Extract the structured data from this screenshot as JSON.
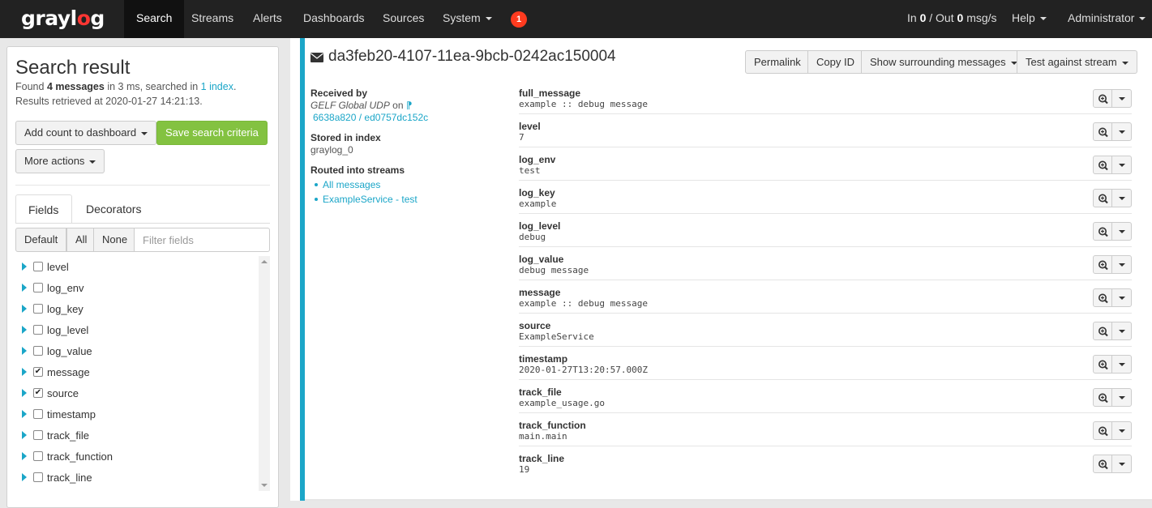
{
  "navbar": {
    "logo": {
      "text_gray": "gray",
      "text_l": "l",
      "text_o": "o",
      "text_g": "g"
    },
    "items": [
      {
        "label": "Search",
        "active": true
      },
      {
        "label": "Streams"
      },
      {
        "label": "Alerts"
      },
      {
        "label": "Dashboards"
      },
      {
        "label": "Sources"
      },
      {
        "label": "System"
      }
    ],
    "notification_count": "1",
    "throughput": {
      "in_label": "In",
      "in_value": "0",
      "sep": "/ Out",
      "out_value": "0",
      "unit": "msg/s"
    },
    "help_label": "Help",
    "user_label": "Administrator"
  },
  "sidebar": {
    "title": "Search result",
    "found_prefix": "Found",
    "found_count": "4 messages",
    "found_mid": "in 3 ms, searched in",
    "found_index_link": "1 index",
    "found_suffix": ".",
    "retrieved": "Results retrieved at 2020-01-27 14:21:13.",
    "add_count_button": "Add count to dashboard",
    "save_search_button": "Save search criteria",
    "more_actions_button": "More actions",
    "tabs": {
      "fields": "Fields",
      "decorators": "Decorators"
    },
    "filter": {
      "default": "Default",
      "all": "All",
      "none": "None",
      "placeholder": "Filter fields"
    },
    "fields": [
      {
        "name": "level",
        "checked": false
      },
      {
        "name": "log_env",
        "checked": false
      },
      {
        "name": "log_key",
        "checked": false
      },
      {
        "name": "log_level",
        "checked": false
      },
      {
        "name": "log_value",
        "checked": false
      },
      {
        "name": "message",
        "checked": true
      },
      {
        "name": "source",
        "checked": true
      },
      {
        "name": "timestamp",
        "checked": false
      },
      {
        "name": "track_file",
        "checked": false
      },
      {
        "name": "track_function",
        "checked": false
      },
      {
        "name": "track_line",
        "checked": false
      }
    ]
  },
  "message": {
    "id": "da3feb20-4107-11ea-9bcb-0242ac150004",
    "buttons": {
      "permalink": "Permalink",
      "copy_id": "Copy ID",
      "surrounding": "Show surrounding messages",
      "test_stream": "Test against stream"
    },
    "received_by_label": "Received by",
    "received_by_input": "GELF Global UDP",
    "received_on": "on",
    "received_node": "6638a820 / ed0757dc152c",
    "stored_label": "Stored in index",
    "stored_value": "graylog_0",
    "routed_label": "Routed into streams",
    "streams": [
      "All messages",
      "ExampleService - test"
    ],
    "fields": [
      {
        "key": "full_message",
        "value": "example :: debug message"
      },
      {
        "key": "level",
        "value": "7"
      },
      {
        "key": "log_env",
        "value": "test"
      },
      {
        "key": "log_key",
        "value": "example"
      },
      {
        "key": "log_level",
        "value": "debug"
      },
      {
        "key": "log_value",
        "value": "debug message"
      },
      {
        "key": "message",
        "value": "example :: debug message"
      },
      {
        "key": "source",
        "value": "ExampleService"
      },
      {
        "key": "timestamp",
        "value": "2020-01-27T13:20:57.000Z"
      },
      {
        "key": "track_file",
        "value": "example_usage.go"
      },
      {
        "key": "track_function",
        "value": "main.main"
      },
      {
        "key": "track_line",
        "value": "19"
      }
    ]
  },
  "colors": {
    "navbar_bg": "#222222",
    "accent_blue": "#1ba6c8",
    "badge_red": "#ff3b1f",
    "save_green": "#83c241",
    "logo_red": "#ff3633"
  }
}
